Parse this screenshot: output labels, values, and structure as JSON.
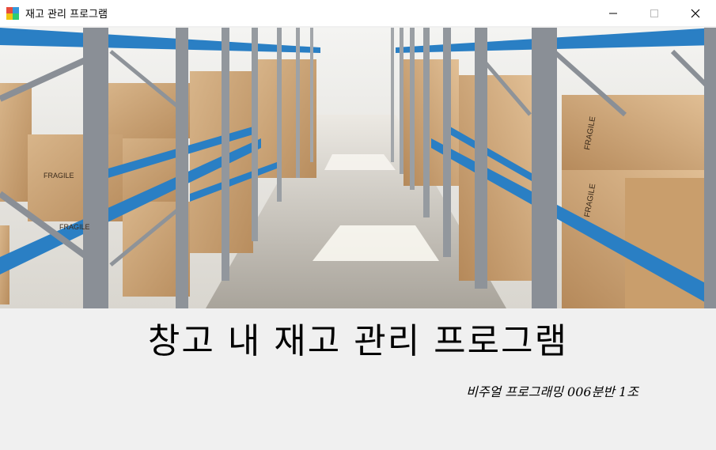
{
  "window": {
    "title": "재고 관리 프로그램",
    "controls": {
      "minimize_icon": "minimize-icon",
      "maximize_icon": "maximize-icon",
      "close_icon": "close-icon"
    }
  },
  "banner": {
    "image": "warehouse-shelves-image",
    "box_label": "FRAGILE"
  },
  "main": {
    "title": "창고 내 재고 관리 프로그램",
    "subtitle": "비주얼 프로그래밍 006분반 1조"
  },
  "colors": {
    "shelf_blue": "#2a7fc4",
    "box_brown": "#c9a273",
    "background": "#f0f0f0"
  }
}
